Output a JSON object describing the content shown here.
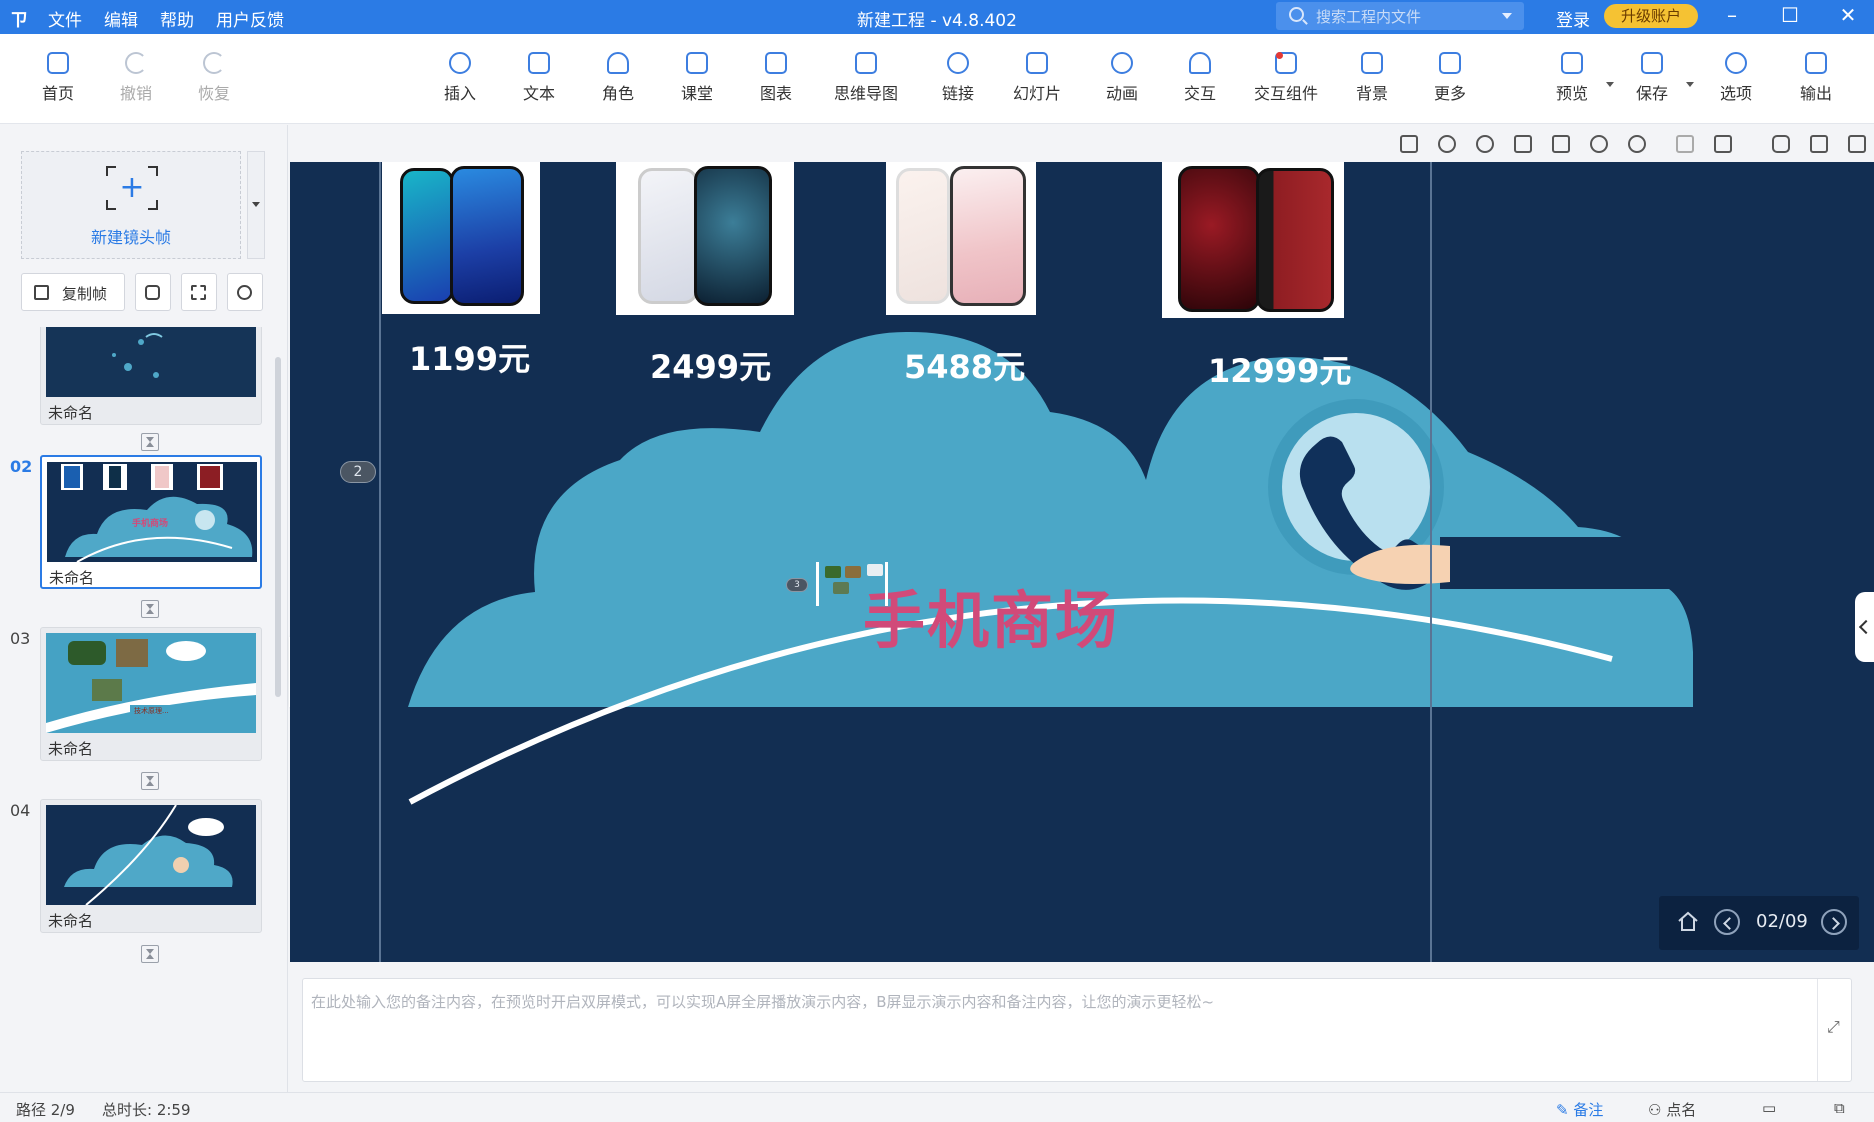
{
  "titlebar": {
    "menu": [
      "文件",
      "编辑",
      "帮助",
      "用户反馈"
    ],
    "title": "新建工程 - v4.8.402",
    "search_placeholder": "搜索工程内文件",
    "login": "登录",
    "upgrade": "升级账户"
  },
  "toolbar": {
    "home": "首页",
    "undo": "撤销",
    "redo": "恢复",
    "insert": "插入",
    "text": "文本",
    "role": "角色",
    "classroom": "课堂",
    "chart": "图表",
    "mindmap": "思维导图",
    "link": "链接",
    "slides": "幻灯片",
    "animation": "动画",
    "interaction": "交互",
    "interaction_widget": "交互组件",
    "background": "背景",
    "more": "更多",
    "preview": "预览",
    "save": "保存",
    "options": "选项",
    "export": "输出"
  },
  "leftpanel": {
    "new_frame": "新建镜头帧",
    "copy_frame": "复制帧",
    "thumbs": [
      {
        "num": "",
        "name": "未命名"
      },
      {
        "num": "02",
        "name": "未命名"
      },
      {
        "num": "03",
        "name": "未命名"
      },
      {
        "num": "04",
        "name": "未命名"
      }
    ]
  },
  "slide": {
    "prices": [
      "1199元",
      "2499元",
      "5488元",
      "12999元"
    ],
    "headline": "手机商场",
    "frame_badge_main": "2",
    "frame_badge_small": "3",
    "page_indicator": "02/09"
  },
  "notes": {
    "placeholder": "在此处输入您的备注内容，在预览时开启双屏模式，可以实现A屏全屏播放演示内容，B屏显示演示内容和备注内容，让您的演示更轻松~"
  },
  "status": {
    "path": "路径 2/9",
    "duration": "总时长: 2:59",
    "notes_btn": "备注",
    "rollcall_btn": "点名"
  },
  "colors": {
    "accent": "#2b7be5",
    "stage_bg": "#122e52",
    "cloud": "#4fa8c8",
    "headline": "#d14a79"
  }
}
